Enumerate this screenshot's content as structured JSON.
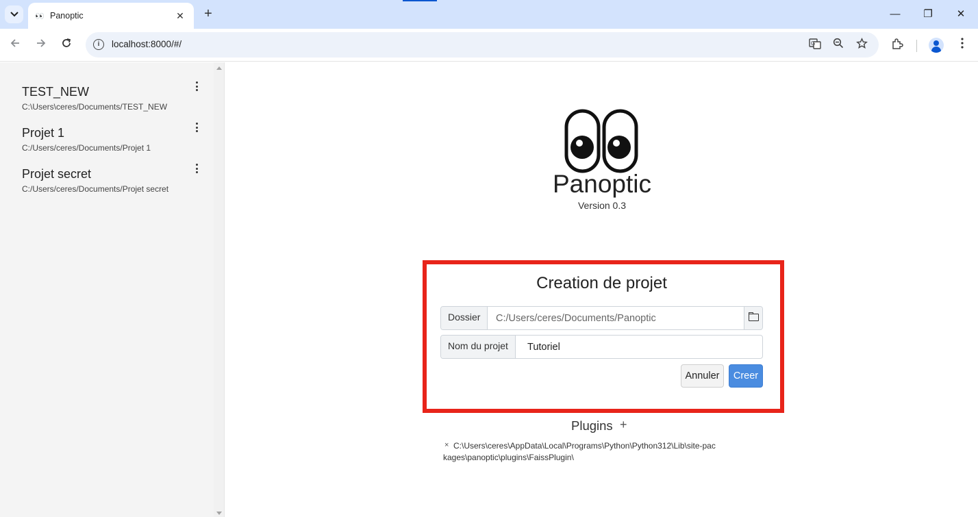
{
  "browser": {
    "tab_title": "Panoptic",
    "tab_favicon": "👀",
    "tab_close": "✕",
    "new_tab": "+",
    "url": "localhost:8000/#/",
    "window_controls": {
      "minimize": "—",
      "restore": "❐",
      "close": "✕"
    }
  },
  "sidebar": {
    "projects": [
      {
        "name": "TEST_NEW",
        "path": "C:\\Users\\ceres/Documents/TEST_NEW"
      },
      {
        "name": "Projet 1",
        "path": "C:/Users/ceres/Documents/Projet 1"
      },
      {
        "name": "Projet secret",
        "path": "C:/Users/ceres/Documents/Projet secret"
      }
    ]
  },
  "app": {
    "name": "Panoptic",
    "version": "Version 0.3"
  },
  "create_form": {
    "title": "Creation de projet",
    "folder_label": "Dossier",
    "folder_placeholder": "C:/Users/ceres/Documents/Panoptic",
    "folder_value": "",
    "name_label": "Nom du projet",
    "name_value": "Tutoriel",
    "cancel_label": "Annuler",
    "create_label": "Creer"
  },
  "plugins": {
    "title": "Plugins",
    "add": "+",
    "items": [
      {
        "remove": "×",
        "path": "C:\\Users\\ceres\\AppData\\Local\\Programs\\Python\\Python312\\Lib\\site-packages\\panoptic\\plugins\\FaissPlugin\\"
      }
    ]
  },
  "colors": {
    "highlight": "#e8241a",
    "primary_button": "#4a8ce0",
    "tabstrip": "#d3e3fd"
  }
}
